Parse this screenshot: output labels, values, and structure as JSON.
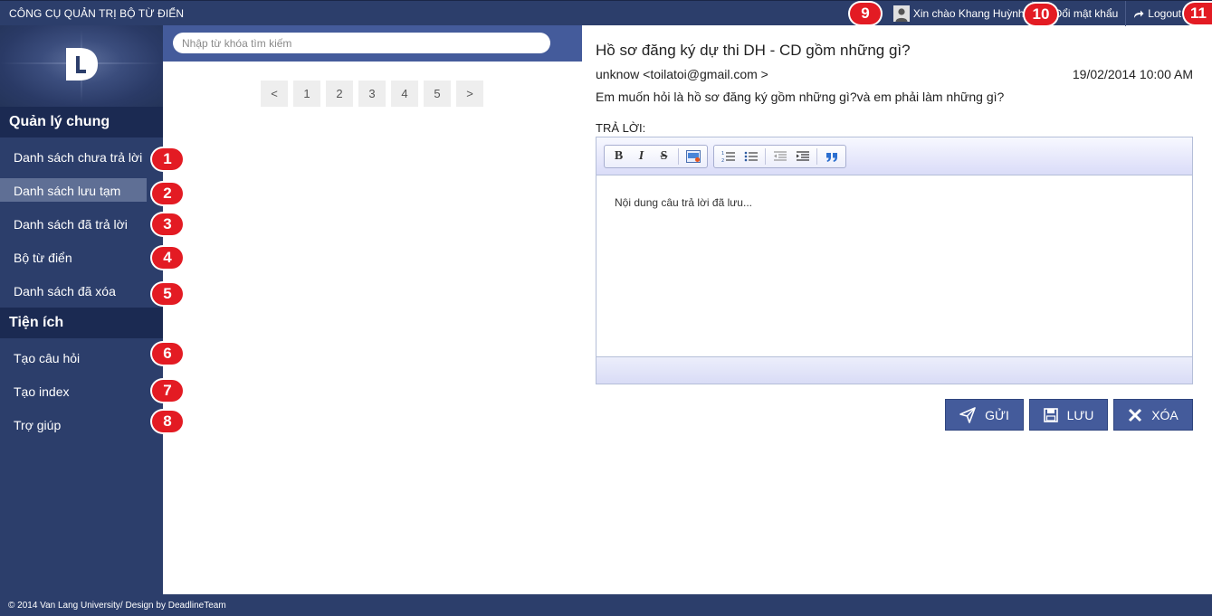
{
  "header": {
    "app_title": "CÔNG CỤ QUẢN TRỊ BỘ TỪ ĐIỂN",
    "greeting": "Xin chào Khang Huỳnh",
    "change_password": "Đổi mật khẩu",
    "logout": "Logout"
  },
  "sidebar": {
    "logo_text": "DL",
    "sections": [
      {
        "title": "Quản lý chung",
        "items": [
          {
            "label": "Danh sách chưa trả lời",
            "badge": "1"
          },
          {
            "label": "Danh sách lưu tạm",
            "badge": "2",
            "active": true
          },
          {
            "label": "Danh sách đã trả lời",
            "badge": "3"
          },
          {
            "label": "Bộ từ điển",
            "badge": "4"
          },
          {
            "label": "Danh sách đã xóa",
            "badge": "5"
          }
        ]
      },
      {
        "title": "Tiện ích",
        "items": [
          {
            "label": "Tạo câu hỏi",
            "badge": "6"
          },
          {
            "label": "Tạo index",
            "badge": "7"
          },
          {
            "label": "Trợ giúp",
            "badge": "8"
          }
        ]
      }
    ]
  },
  "top_badges": {
    "greeting": "9",
    "change_password": "10",
    "logout": "11"
  },
  "search": {
    "placeholder": "Nhập từ khóa tìm kiếm",
    "value": ""
  },
  "pagination": {
    "prev": "<",
    "pages": [
      "1",
      "2",
      "3",
      "4",
      "5"
    ],
    "next": ">"
  },
  "question": {
    "title": "Hồ sơ đăng ký dự thi DH - CD gồm những gì?",
    "from": "unknow <toilatoi@gmail.com >",
    "date": "19/02/2014 10:00 AM",
    "body": "Em muốn hỏi là hồ sơ đăng ký gồm những gì?và em phải làm những gì?"
  },
  "reply": {
    "label": "TRẢ LỜI:",
    "content": "Nội dung câu trả lời đã lưu...",
    "toolbar": {
      "bold": "B",
      "italic": "I",
      "strike": "S"
    }
  },
  "actions": {
    "send": "GỬI",
    "save": "LƯU",
    "delete": "XÓA"
  },
  "footer": {
    "text": "© 2014 Van Lang University/ Design by DeadlineTeam"
  },
  "colors": {
    "navy": "#2c3e6b",
    "navy_dark": "#1b2a52",
    "accent_blue": "#445b9b",
    "badge_red": "#e31b23",
    "active_item": "#5f6f95"
  }
}
